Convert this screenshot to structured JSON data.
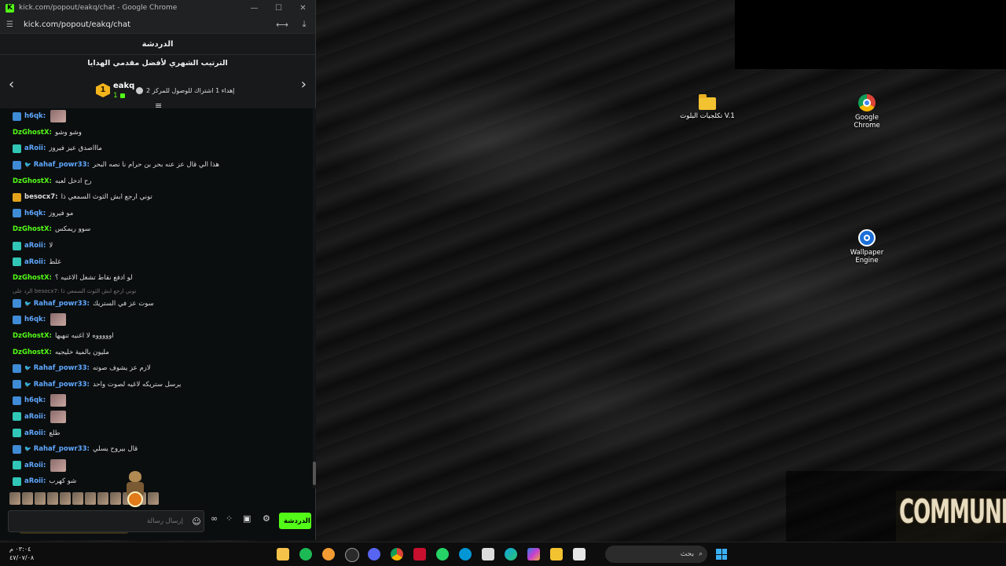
{
  "browser": {
    "window_title": "kick.com/popout/eakq/chat - Google Chrome",
    "url": "kick.com/popout/eakq/chat",
    "controls": {
      "minimize": "—",
      "maximize": "☐",
      "close": "✕"
    }
  },
  "chat": {
    "header": "الدردشة",
    "leaderboard": {
      "title": "الترتيب الشهري لأفضل مقدمي الهدايا",
      "rank": "1",
      "user": "eakq",
      "count": "1",
      "note": "إهداء 1 اشتراك للوصول للمركز 2"
    },
    "messages": [
      {
        "user": "h6qk:",
        "text": "",
        "color": "#5fa8ff",
        "badge": "vip",
        "emote": true
      },
      {
        "user": "DzGhostX:",
        "text": "وشو وشو",
        "color": "#53fc18",
        "badge": ""
      },
      {
        "user": "aRoii:",
        "text": "ماااصدق عيز فيروز",
        "color": "#5fa8ff",
        "badge": "sub"
      },
      {
        "user": "Rahaf_powr33:",
        "text": "هذا الي قال عز عنه بحر بن حرام نا نصه البحر",
        "color": "#5fa8ff",
        "badge": "vip",
        "second_badge": "🐦"
      },
      {
        "user": "DzGhostX:",
        "text": "رح ادخل لعبه",
        "color": "#53fc18",
        "badge": ""
      },
      {
        "user": "besocx7:",
        "text": "توني ارجع ابش الثوث السمعي ذا",
        "color": "#ddd",
        "badge": "crown"
      },
      {
        "user": "h6qk:",
        "text": "مو فيروز",
        "color": "#5fa8ff",
        "badge": "vip"
      },
      {
        "user": "DzGhostX:",
        "text": "سوو ريمكس",
        "color": "#53fc18",
        "badge": ""
      },
      {
        "user": "aRoii:",
        "text": "لا",
        "color": "#5fa8ff",
        "badge": "sub"
      },
      {
        "user": "aRoii:",
        "text": "غلط",
        "color": "#5fa8ff",
        "badge": "sub"
      },
      {
        "user": "DzGhostX:",
        "text": "لو ادفع نقاط تشغل الاغنيه ؟",
        "color": "#53fc18",
        "badge": ""
      },
      {
        "reply": "الرد على besocx7: توني ارجع ابش الثوث السمعي ذا"
      },
      {
        "user": "Rahaf_powr33:",
        "text": "سوت عز في الستريك",
        "color": "#5fa8ff",
        "badge": "vip",
        "second_badge": "🐦"
      },
      {
        "user": "h6qk:",
        "text": "",
        "color": "#5fa8ff",
        "badge": "vip",
        "emote": true
      },
      {
        "user": "DzGhostX:",
        "text": "اوووووه لا اغنيه تنهيها",
        "color": "#53fc18",
        "badge": ""
      },
      {
        "user": "DzGhostX:",
        "text": "مليون بالمية خليجيه",
        "color": "#53fc18",
        "badge": ""
      },
      {
        "user": "Rahaf_powr33:",
        "text": "لازم عز يشوف صوته",
        "color": "#5fa8ff",
        "badge": "vip",
        "second_badge": "🐦"
      },
      {
        "user": "Rahaf_powr33:",
        "text": "يرسل ستريكه لاغيه لصوت واحد",
        "color": "#5fa8ff",
        "badge": "vip",
        "second_badge": "🐦"
      },
      {
        "user": "h6qk:",
        "text": "",
        "color": "#5fa8ff",
        "badge": "vip",
        "emote": true
      },
      {
        "user": "aRoii:",
        "text": "",
        "color": "#5fa8ff",
        "badge": "sub",
        "emote": true
      },
      {
        "user": "aRoii:",
        "text": "طلع",
        "color": "#5fa8ff",
        "badge": "sub"
      },
      {
        "user": "Rahaf_powr33:",
        "text": "قال بيروح يسلي",
        "color": "#5fa8ff",
        "badge": "vip",
        "second_badge": "🐦"
      },
      {
        "user": "aRoii:",
        "text": "",
        "color": "#5fa8ff",
        "badge": "sub",
        "emote": true
      },
      {
        "user": "aRoii:",
        "text": "شو كهرب",
        "color": "#5fa8ff",
        "badge": "sub"
      }
    ],
    "input": {
      "placeholder": "إرسال رسالة"
    },
    "send_label": "الدردشة"
  },
  "desktop": {
    "icons": [
      {
        "label": "تكلجيات البلوت V.1",
        "kind": "folder"
      },
      {
        "label": "Google Chrome",
        "kind": "chrome"
      },
      {
        "label": "Wallpaper Engine",
        "kind": "wallpaper-engine"
      }
    ],
    "watermark": "COMMUNITY"
  },
  "taskbar": {
    "time": "٠٣:٠٤ م",
    "date": "٤٧/٠٧/٠٨",
    "search_placeholder": "بحث",
    "apps": [
      "notes",
      "spotify",
      "app",
      "steam",
      "discord",
      "chrome",
      "antivirus",
      "whatsapp",
      "hp",
      "store",
      "edge",
      "copilot",
      "file-explorer",
      "terminal"
    ]
  }
}
